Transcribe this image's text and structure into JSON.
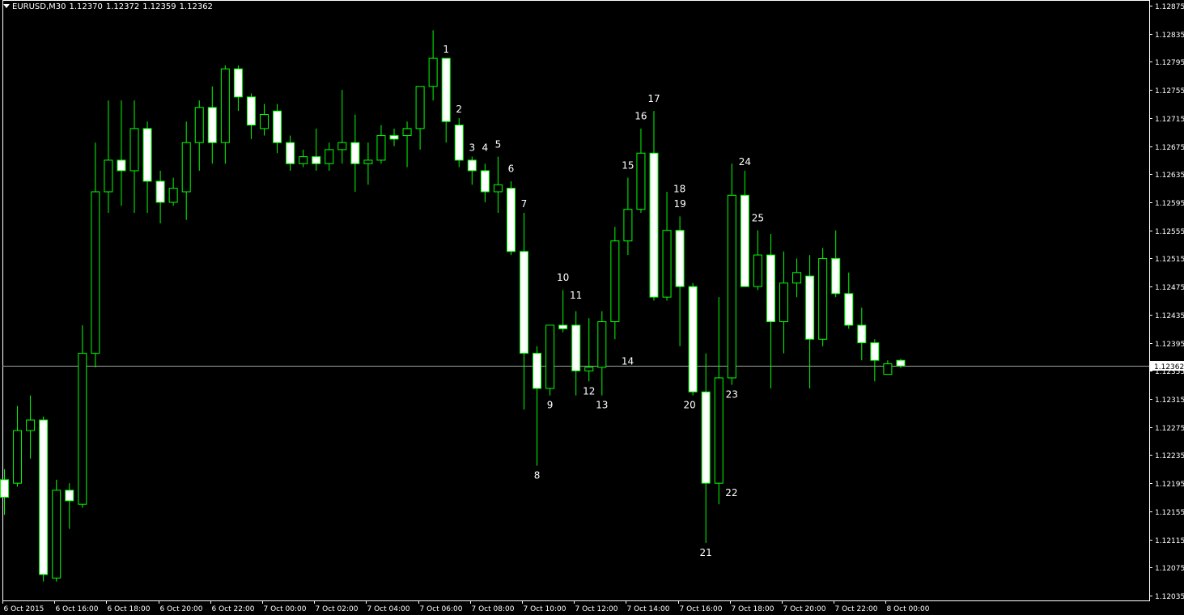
{
  "header": {
    "symbol_timeframe": "EURUSD,M30",
    "open": "1.12370",
    "high": "1.12372",
    "low": "1.12359",
    "close": "1.12362"
  },
  "colors": {
    "background": "#000000",
    "grid_and_axes": "#ffffff",
    "wick_and_bear_outline": "#00ff00",
    "bull_body": "#000000",
    "bear_body": "#ffffff",
    "bid_line": "#9aa79a",
    "price_tag_bg": "#ffffff",
    "label_text": "#ffffff"
  },
  "chart_data": {
    "type": "candlestick",
    "symbol": "EURUSD",
    "timeframe": "M30",
    "current_price": "1.12362",
    "y_range": [
      1.12015,
      1.12885
    ],
    "y_ticks": [
      "1.12875",
      "1.12835",
      "1.12795",
      "1.12755",
      "1.12715",
      "1.12675",
      "1.12635",
      "1.12595",
      "1.12555",
      "1.12515",
      "1.12475",
      "1.12435",
      "1.12395",
      "1.12355",
      "1.12315",
      "1.12275",
      "1.12235",
      "1.12195",
      "1.12155",
      "1.12115",
      "1.12075",
      "1.12035"
    ],
    "x_ticks": [
      "6 Oct 2015",
      "6 Oct 16:00",
      "6 Oct 18:00",
      "6 Oct 20:00",
      "6 Oct 22:00",
      "7 Oct 00:00",
      "7 Oct 02:00",
      "7 Oct 04:00",
      "7 Oct 06:00",
      "7 Oct 08:00",
      "7 Oct 10:00",
      "7 Oct 12:00",
      "7 Oct 14:00",
      "7 Oct 16:00",
      "7 Oct 18:00",
      "7 Oct 20:00",
      "7 Oct 22:00",
      "8 Oct 00:00"
    ],
    "candles": [
      {
        "o": 1.122,
        "h": 1.12215,
        "l": 1.1215,
        "c": 1.12175
      },
      {
        "o": 1.12195,
        "h": 1.12305,
        "l": 1.1219,
        "c": 1.1227
      },
      {
        "o": 1.1227,
        "h": 1.1232,
        "l": 1.1223,
        "c": 1.12285
      },
      {
        "o": 1.12285,
        "h": 1.1229,
        "l": 1.12055,
        "c": 1.12065
      },
      {
        "o": 1.1206,
        "h": 1.122,
        "l": 1.12055,
        "c": 1.12185
      },
      {
        "o": 1.12185,
        "h": 1.12195,
        "l": 1.1213,
        "c": 1.1217
      },
      {
        "o": 1.12165,
        "h": 1.1242,
        "l": 1.1216,
        "c": 1.1238
      },
      {
        "o": 1.1238,
        "h": 1.1268,
        "l": 1.1236,
        "c": 1.1261
      },
      {
        "o": 1.1261,
        "h": 1.1274,
        "l": 1.1258,
        "c": 1.12655
      },
      {
        "o": 1.12655,
        "h": 1.1274,
        "l": 1.1259,
        "c": 1.1264
      },
      {
        "o": 1.1264,
        "h": 1.1274,
        "l": 1.1258,
        "c": 1.127
      },
      {
        "o": 1.127,
        "h": 1.1271,
        "l": 1.1258,
        "c": 1.12625
      },
      {
        "o": 1.12625,
        "h": 1.1264,
        "l": 1.12565,
        "c": 1.12595
      },
      {
        "o": 1.12595,
        "h": 1.1263,
        "l": 1.1259,
        "c": 1.12615
      },
      {
        "o": 1.1261,
        "h": 1.1271,
        "l": 1.1257,
        "c": 1.1268
      },
      {
        "o": 1.1268,
        "h": 1.1274,
        "l": 1.1264,
        "c": 1.1273
      },
      {
        "o": 1.1273,
        "h": 1.1276,
        "l": 1.1265,
        "c": 1.1268
      },
      {
        "o": 1.1268,
        "h": 1.1279,
        "l": 1.1265,
        "c": 1.12785
      },
      {
        "o": 1.12785,
        "h": 1.1279,
        "l": 1.12725,
        "c": 1.12745
      },
      {
        "o": 1.12745,
        "h": 1.1275,
        "l": 1.12685,
        "c": 1.12705
      },
      {
        "o": 1.127,
        "h": 1.12735,
        "l": 1.1269,
        "c": 1.1272
      },
      {
        "o": 1.12725,
        "h": 1.12735,
        "l": 1.12665,
        "c": 1.1268
      },
      {
        "o": 1.1268,
        "h": 1.1269,
        "l": 1.1264,
        "c": 1.1265
      },
      {
        "o": 1.1265,
        "h": 1.1267,
        "l": 1.12645,
        "c": 1.1266
      },
      {
        "o": 1.1266,
        "h": 1.127,
        "l": 1.1264,
        "c": 1.1265
      },
      {
        "o": 1.1265,
        "h": 1.1268,
        "l": 1.1264,
        "c": 1.1267
      },
      {
        "o": 1.1267,
        "h": 1.12755,
        "l": 1.1265,
        "c": 1.1268
      },
      {
        "o": 1.1268,
        "h": 1.1272,
        "l": 1.1261,
        "c": 1.1265
      },
      {
        "o": 1.1265,
        "h": 1.1268,
        "l": 1.1262,
        "c": 1.12655
      },
      {
        "o": 1.12655,
        "h": 1.12705,
        "l": 1.1265,
        "c": 1.1269
      },
      {
        "o": 1.1269,
        "h": 1.127,
        "l": 1.12675,
        "c": 1.12685
      },
      {
        "o": 1.1269,
        "h": 1.1271,
        "l": 1.12645,
        "c": 1.127
      },
      {
        "o": 1.127,
        "h": 1.1276,
        "l": 1.1267,
        "c": 1.1276
      },
      {
        "o": 1.1276,
        "h": 1.1284,
        "l": 1.1274,
        "c": 1.128
      },
      {
        "o": 1.128,
        "h": 1.128,
        "l": 1.1268,
        "c": 1.1271
      },
      {
        "o": 1.12705,
        "h": 1.12715,
        "l": 1.12645,
        "c": 1.12655
      },
      {
        "o": 1.12655,
        "h": 1.1266,
        "l": 1.1262,
        "c": 1.1264
      },
      {
        "o": 1.1264,
        "h": 1.1265,
        "l": 1.12595,
        "c": 1.1261
      },
      {
        "o": 1.1261,
        "h": 1.1266,
        "l": 1.1258,
        "c": 1.1262
      },
      {
        "o": 1.12615,
        "h": 1.12625,
        "l": 1.1252,
        "c": 1.12525
      },
      {
        "o": 1.12525,
        "h": 1.1258,
        "l": 1.123,
        "c": 1.1238
      },
      {
        "o": 1.1238,
        "h": 1.1239,
        "l": 1.1222,
        "c": 1.1233
      },
      {
        "o": 1.1233,
        "h": 1.1242,
        "l": 1.1232,
        "c": 1.1242
      },
      {
        "o": 1.1242,
        "h": 1.1247,
        "l": 1.1241,
        "c": 1.12415
      },
      {
        "o": 1.1242,
        "h": 1.1244,
        "l": 1.1232,
        "c": 1.12355
      },
      {
        "o": 1.12355,
        "h": 1.1243,
        "l": 1.1234,
        "c": 1.1236
      },
      {
        "o": 1.1236,
        "h": 1.1244,
        "l": 1.1232,
        "c": 1.12425
      },
      {
        "o": 1.12425,
        "h": 1.1256,
        "l": 1.124,
        "c": 1.1254
      },
      {
        "o": 1.1254,
        "h": 1.1263,
        "l": 1.1252,
        "c": 1.12585
      },
      {
        "o": 1.12585,
        "h": 1.127,
        "l": 1.1258,
        "c": 1.12665
      },
      {
        "o": 1.12665,
        "h": 1.12725,
        "l": 1.12455,
        "c": 1.1246
      },
      {
        "o": 1.1246,
        "h": 1.1261,
        "l": 1.12455,
        "c": 1.12555
      },
      {
        "o": 1.12555,
        "h": 1.12575,
        "l": 1.1239,
        "c": 1.12475
      },
      {
        "o": 1.12475,
        "h": 1.1248,
        "l": 1.1232,
        "c": 1.12325
      },
      {
        "o": 1.12325,
        "h": 1.1238,
        "l": 1.1211,
        "c": 1.12195
      },
      {
        "o": 1.12195,
        "h": 1.1246,
        "l": 1.12165,
        "c": 1.12345
      },
      {
        "o": 1.12345,
        "h": 1.1265,
        "l": 1.12335,
        "c": 1.12605
      },
      {
        "o": 1.12605,
        "h": 1.1264,
        "l": 1.12475,
        "c": 1.12475
      },
      {
        "o": 1.12475,
        "h": 1.12555,
        "l": 1.1247,
        "c": 1.1252
      },
      {
        "o": 1.1252,
        "h": 1.1255,
        "l": 1.1233,
        "c": 1.12425
      },
      {
        "o": 1.12425,
        "h": 1.12525,
        "l": 1.1238,
        "c": 1.1248
      },
      {
        "o": 1.1248,
        "h": 1.12515,
        "l": 1.1246,
        "c": 1.12495
      },
      {
        "o": 1.1249,
        "h": 1.1252,
        "l": 1.1233,
        "c": 1.124
      },
      {
        "o": 1.124,
        "h": 1.1253,
        "l": 1.1239,
        "c": 1.12515
      },
      {
        "o": 1.12515,
        "h": 1.12555,
        "l": 1.1246,
        "c": 1.12465
      },
      {
        "o": 1.12465,
        "h": 1.12495,
        "l": 1.12415,
        "c": 1.1242
      },
      {
        "o": 1.1242,
        "h": 1.12445,
        "l": 1.1237,
        "c": 1.12395
      },
      {
        "o": 1.12395,
        "h": 1.124,
        "l": 1.1234,
        "c": 1.1237
      },
      {
        "o": 1.1235,
        "h": 1.1237,
        "l": 1.1235,
        "c": 1.12365
      },
      {
        "o": 1.1237,
        "h": 1.12372,
        "l": 1.12359,
        "c": 1.12362
      }
    ],
    "annotations": [
      {
        "text": "1",
        "candle": 34,
        "price": 1.128,
        "pos": "above"
      },
      {
        "text": "2",
        "candle": 35,
        "price": 1.12715,
        "pos": "above"
      },
      {
        "text": "3",
        "candle": 36,
        "price": 1.1266,
        "pos": "above"
      },
      {
        "text": "4",
        "candle": 37,
        "price": 1.1266,
        "pos": "above"
      },
      {
        "text": "5",
        "candle": 38,
        "price": 1.12665,
        "pos": "above"
      },
      {
        "text": "6",
        "candle": 39,
        "price": 1.1263,
        "pos": "above"
      },
      {
        "text": "7",
        "candle": 40,
        "price": 1.1258,
        "pos": "above"
      },
      {
        "text": "8",
        "candle": 41,
        "price": 1.1222,
        "pos": "below"
      },
      {
        "text": "9",
        "candle": 42,
        "price": 1.1232,
        "pos": "below"
      },
      {
        "text": "10",
        "candle": 43,
        "price": 1.12475,
        "pos": "above"
      },
      {
        "text": "11",
        "candle": 44,
        "price": 1.1245,
        "pos": "above"
      },
      {
        "text": "12",
        "candle": 45,
        "price": 1.1234,
        "pos": "below"
      },
      {
        "text": "13",
        "candle": 46,
        "price": 1.1232,
        "pos": "below"
      },
      {
        "text": "14",
        "candle": 47,
        "price": 1.1237,
        "pos": "right"
      },
      {
        "text": "15",
        "candle": 48,
        "price": 1.12635,
        "pos": "above"
      },
      {
        "text": "16",
        "candle": 49,
        "price": 1.12705,
        "pos": "above"
      },
      {
        "text": "17",
        "candle": 50,
        "price": 1.1273,
        "pos": "above"
      },
      {
        "text": "18",
        "candle": 51,
        "price": 1.12615,
        "pos": "right"
      },
      {
        "text": "19",
        "candle": 52,
        "price": 1.1258,
        "pos": "above"
      },
      {
        "text": "20",
        "candle": 53,
        "price": 1.1232,
        "pos": "below-left"
      },
      {
        "text": "21",
        "candle": 54,
        "price": 1.1211,
        "pos": "below"
      },
      {
        "text": "22",
        "candle": 55,
        "price": 1.12195,
        "pos": "below-right"
      },
      {
        "text": "23",
        "candle": 56,
        "price": 1.12335,
        "pos": "below"
      },
      {
        "text": "24",
        "candle": 57,
        "price": 1.1264,
        "pos": "above"
      },
      {
        "text": "25",
        "candle": 58,
        "price": 1.1256,
        "pos": "above"
      }
    ]
  }
}
